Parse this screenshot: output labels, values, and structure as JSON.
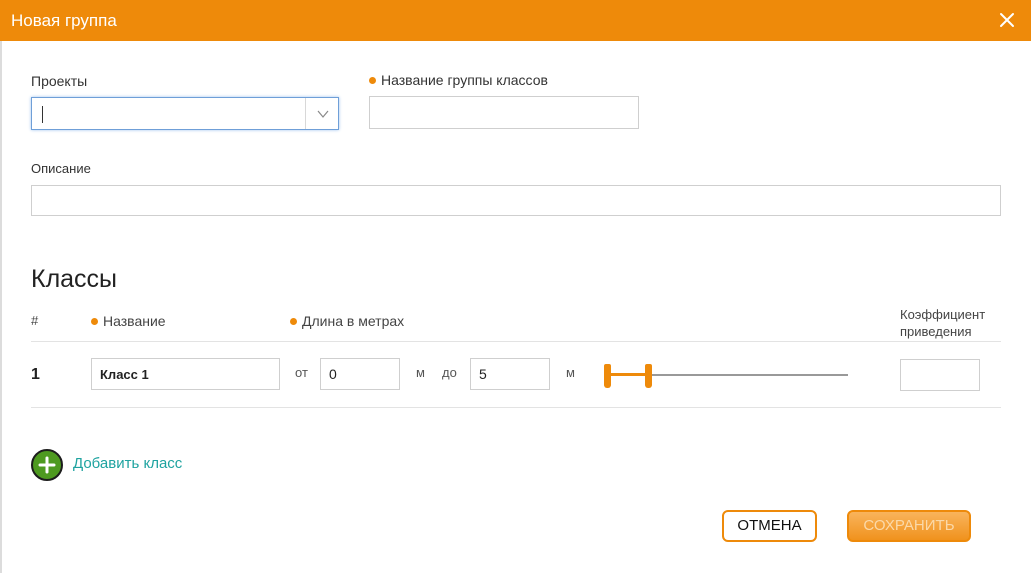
{
  "dialog": {
    "title": "Новая группа",
    "close_icon": "close-icon"
  },
  "form": {
    "projects_label": "Проекты",
    "projects_value": "",
    "group_name_label": "Название группы классов",
    "group_name_value": "",
    "description_label": "Описание",
    "description_value": ""
  },
  "classes": {
    "title": "Классы",
    "headers": {
      "num": "#",
      "name": "Название",
      "length": "Длина в метрах",
      "coef": "Коэффициент приведения"
    },
    "rows": [
      {
        "num": "1",
        "name": "Класс 1",
        "from_label": "от",
        "from_value": "0",
        "unit1": "м",
        "to_label": "до",
        "to_value": "5",
        "unit2": "м",
        "slider_min": 0,
        "slider_max": 5,
        "coef_value": ""
      }
    ],
    "add_label": "Добавить класс"
  },
  "buttons": {
    "cancel": "ОТМЕНА",
    "save": "СОХРАНИТЬ"
  },
  "colors": {
    "accent": "#ee8a0a",
    "add_green": "#4e9a20",
    "link_teal": "#1fa3a0"
  }
}
